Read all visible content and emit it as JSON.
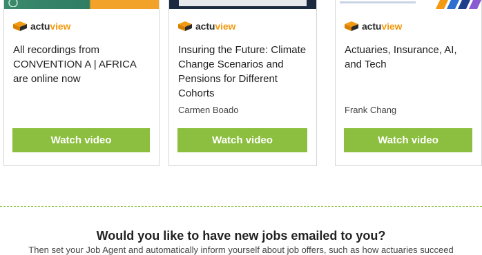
{
  "logo": {
    "part1": "actu",
    "part2": "view"
  },
  "cards": [
    {
      "title": "All recordings from CONVENTION A | AFRICA are online now",
      "author": "",
      "button": "Watch video"
    },
    {
      "title": "Insuring the Future: Climate Change Scenarios and Pensions for Different Cohorts",
      "author": "Carmen Boado",
      "button": "Watch video"
    },
    {
      "title": "Actuaries, Insurance, AI, and Tech",
      "author": "Frank Chang",
      "button": "Watch video"
    }
  ],
  "jobs": {
    "heading": "Would you like to have new jobs emailed to you?",
    "text": "Then set your Job Agent and automatically inform yourself about job offers, such as how actuaries succeed"
  },
  "colors": {
    "accent": "#8cbf3f",
    "logo_orange": "#f39a10"
  }
}
